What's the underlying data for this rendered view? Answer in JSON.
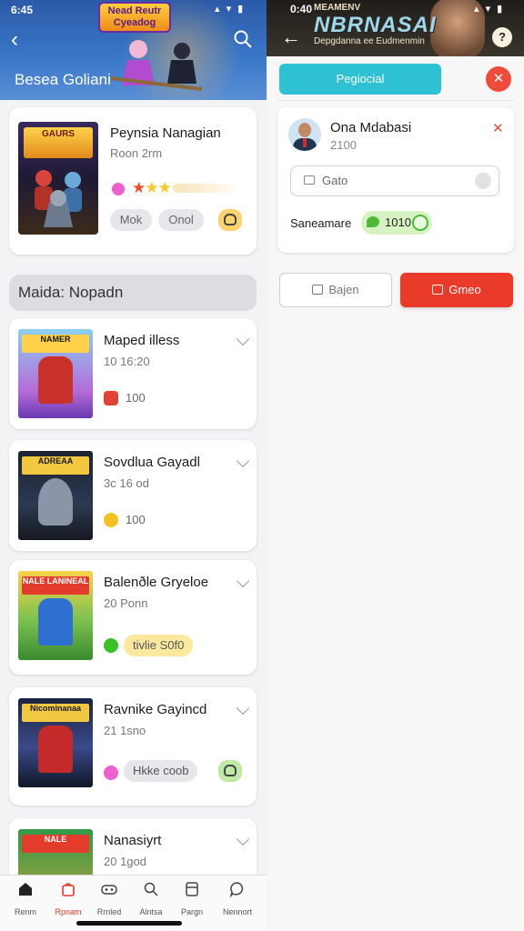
{
  "status_left": {
    "time": "6:45",
    "signal": "▴ ▾ ▮"
  },
  "status_right": {
    "time": "0:40",
    "signal": "▴ ▾ ▮"
  },
  "left": {
    "header": {
      "title": "Besea Goliani",
      "banner_text": "Nead Reutr Cyeadog"
    },
    "featured": {
      "title": "Peynsia Nanagian",
      "subtitle": "Roon 2rm",
      "thumb_text": "GAURS",
      "chip1": "Mok",
      "chip2": "Onol",
      "stars": "★★★"
    },
    "section_title": "Maida: Nopadn",
    "items": [
      {
        "title": "Maped illess",
        "sub": "10 16:20",
        "thumb_text": "NAMER",
        "value": "100"
      },
      {
        "title": "Sovdlua Gayadl",
        "sub": "3c 16 od",
        "thumb_text": "ADREAA",
        "value": "100"
      },
      {
        "title": "Balenðle Gryeloe",
        "sub": "20 Ponn",
        "thumb_text": "NALE LANINEAL",
        "pill": "tivlie S0f0"
      },
      {
        "title": "Ravnike Gayincd",
        "sub": "21 1sno",
        "thumb_text": "Nicominanaa",
        "pill": "Hkke coob"
      },
      {
        "title": "Nanasiyrt",
        "sub": "20 1god",
        "thumb_text": "NALE"
      }
    ],
    "nav": [
      {
        "label": "Renm"
      },
      {
        "label": "Rpnam"
      },
      {
        "label": "Rrnled"
      },
      {
        "label": "Alntsa"
      },
      {
        "label": "Pargn"
      },
      {
        "label": "Nennort"
      }
    ]
  },
  "right": {
    "header": {
      "title": "NBRNASAI",
      "kicker": "MEAMENV",
      "subtitle": "Depgdanna ee Eudmenmin",
      "help": "?"
    },
    "primary_button": "Pegiocial",
    "user": {
      "name": "Ona Mdabasi",
      "sub": "2100",
      "input_value": "Gato",
      "label": "Saneamare",
      "amount": "1010"
    },
    "btn_secondary": "Bajen",
    "btn_primary": "Gmeo"
  },
  "colors": {
    "accent_red": "#ea3a2a",
    "teal": "#2ec1d3",
    "header_blue": "#3b78c9"
  }
}
